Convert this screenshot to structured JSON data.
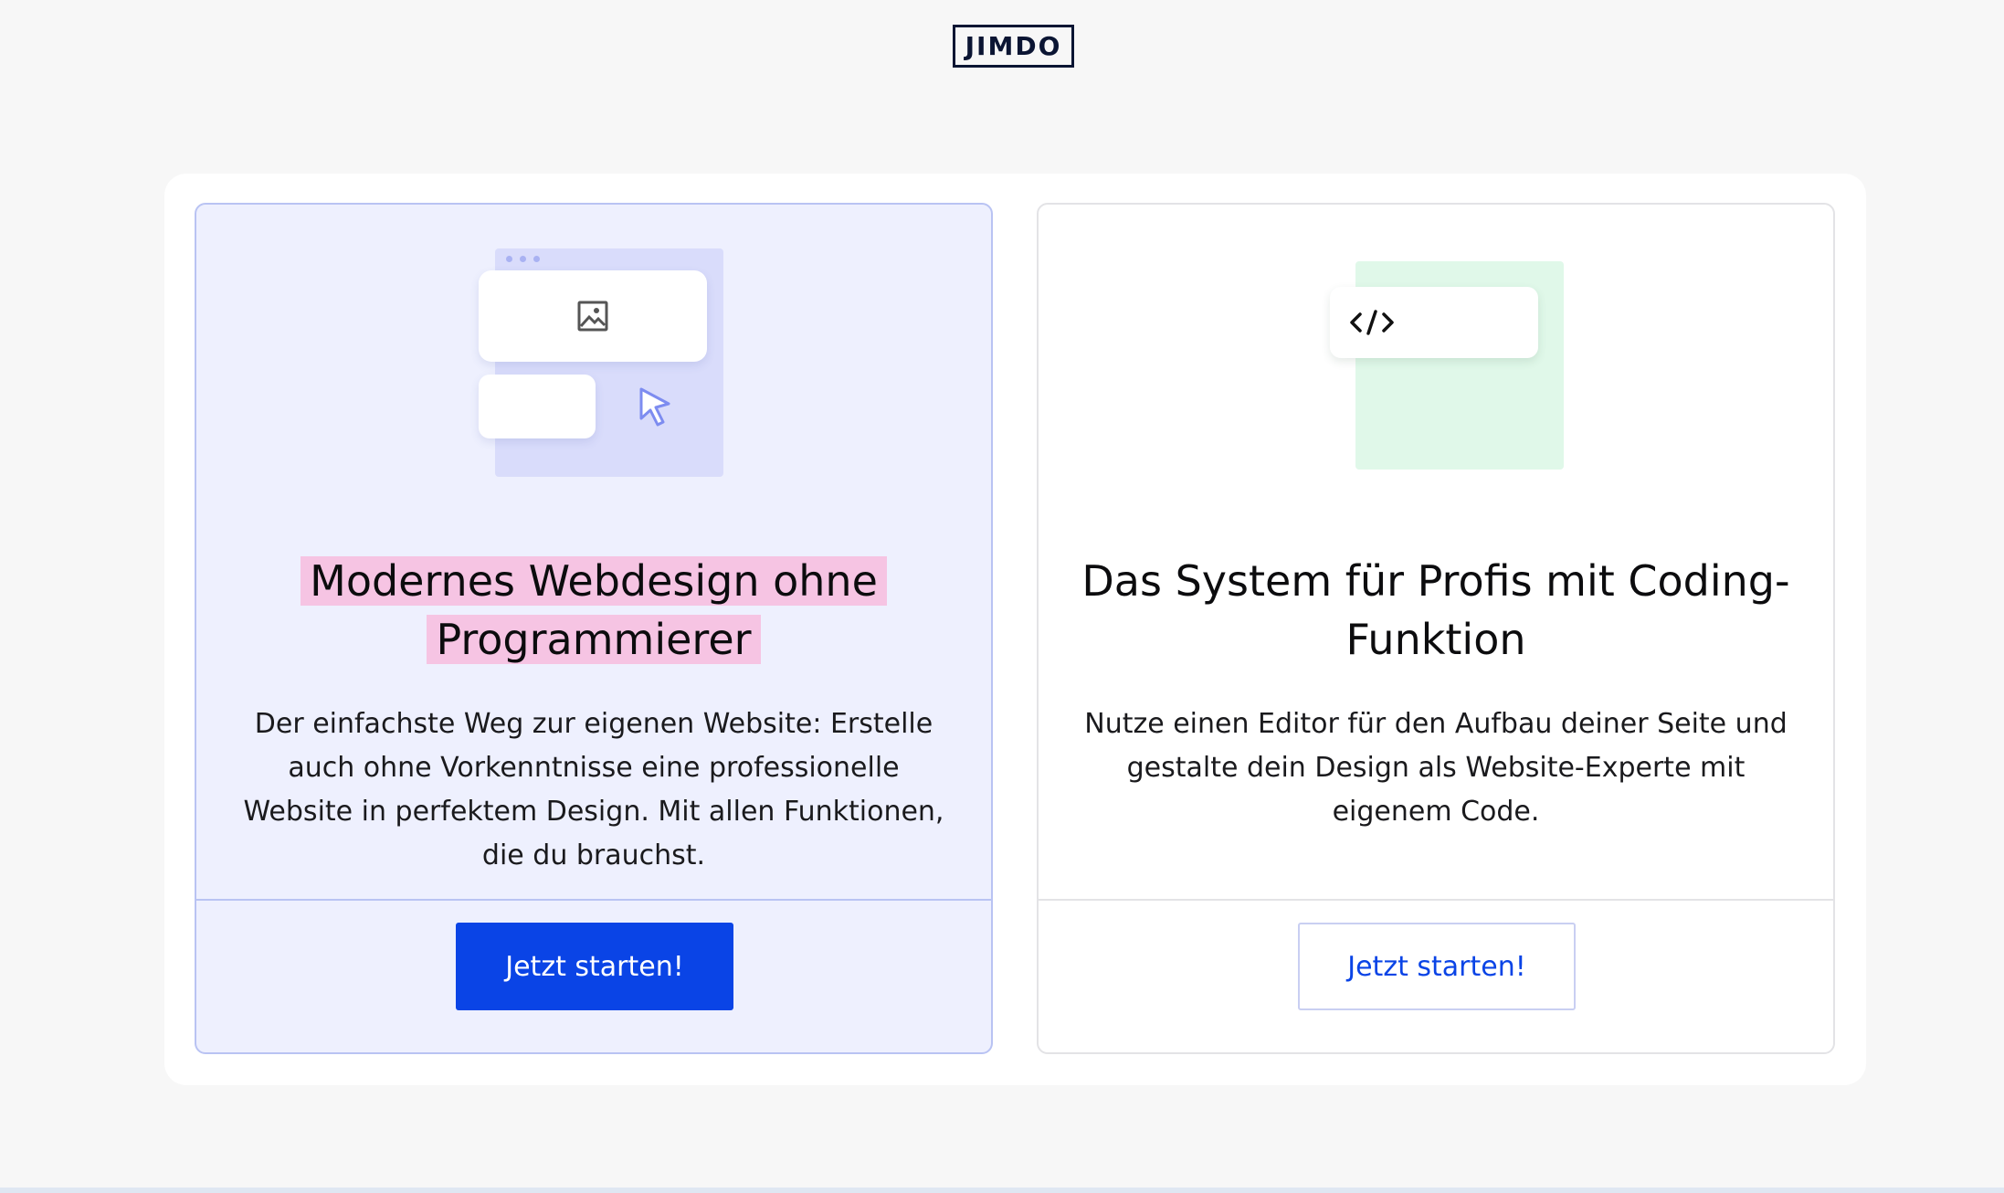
{
  "header": {
    "logo_text": "JIMDO"
  },
  "cards": [
    {
      "title_line1": "Modernes Webdesign ohne",
      "title_line2": "Programmierer",
      "description": "Der einfachste Weg zur eigenen Website: Erstelle auch ohne Vorkenntnisse eine professionelle Website in perfektem Design. Mit allen Funktionen, die du brauchst.",
      "button_label": "Jetzt starten!",
      "illustration_icon": "image-icon",
      "accent_color": "#0a44e6"
    },
    {
      "title": "Das System für Profis mit Coding-Funktion",
      "description": "Nutze einen Editor für den Aufbau deiner Seite und gestalte dein Design als Website-Experte mit eigenem Code.",
      "button_label": "Jetzt starten!",
      "illustration_icon": "code-icon",
      "accent_color": "#0a44e6"
    }
  ]
}
